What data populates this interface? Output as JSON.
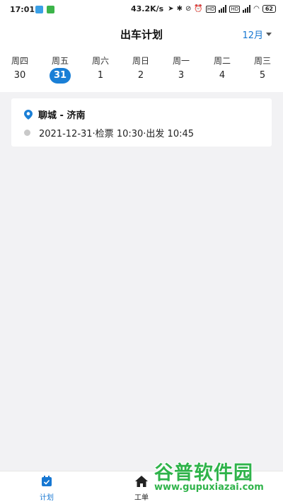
{
  "status_bar": {
    "time": "17:01",
    "network_speed": "43.2K/s",
    "network_label_4g": "4G",
    "network_label_5g": "5G",
    "hd_label": "HD",
    "battery": "62"
  },
  "header": {
    "title": "出车计划",
    "month": "12月"
  },
  "week": [
    {
      "name": "周四",
      "date": "30",
      "selected": false
    },
    {
      "name": "周五",
      "date": "31",
      "selected": true
    },
    {
      "name": "周六",
      "date": "1",
      "selected": false
    },
    {
      "name": "周日",
      "date": "2",
      "selected": false
    },
    {
      "name": "周一",
      "date": "3",
      "selected": false
    },
    {
      "name": "周二",
      "date": "4",
      "selected": false
    },
    {
      "name": "周三",
      "date": "5",
      "selected": false
    }
  ],
  "trip": {
    "route": "聊城 - 济南",
    "schedule": "2021-12-31·检票 10:30·出发 10:45"
  },
  "tabbar": {
    "plan_label": "计划",
    "workorder_label": "工单"
  },
  "watermark": {
    "main": "谷普软件园",
    "url": "www.gupuxiazai.com"
  },
  "colors": {
    "accent": "#1677d2",
    "selected_day": "#1a7fd6",
    "background": "#f2f2f4"
  }
}
